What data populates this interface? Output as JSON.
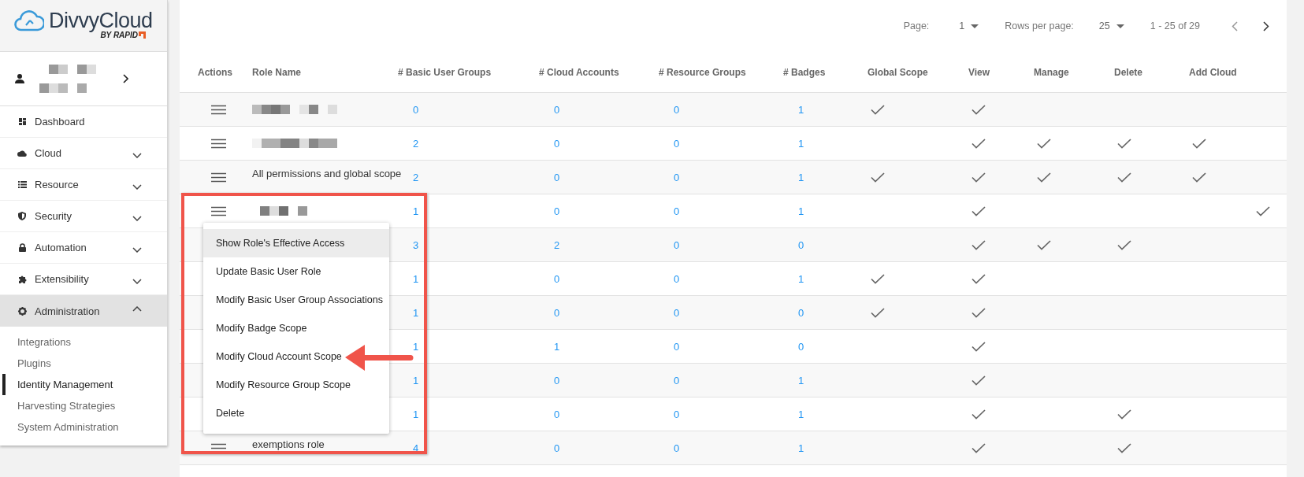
{
  "logo": {
    "name": "DivvyCloud",
    "byline": "BY RAPID"
  },
  "sidebar": {
    "items": [
      {
        "label": "Dashboard",
        "expandable": false,
        "expanded": false
      },
      {
        "label": "Cloud",
        "expandable": true,
        "expanded": false
      },
      {
        "label": "Resource",
        "expandable": true,
        "expanded": false
      },
      {
        "label": "Security",
        "expandable": true,
        "expanded": false
      },
      {
        "label": "Automation",
        "expandable": true,
        "expanded": false
      },
      {
        "label": "Extensibility",
        "expandable": true,
        "expanded": false
      },
      {
        "label": "Administration",
        "expandable": true,
        "expanded": true,
        "children": [
          {
            "label": "Integrations",
            "selected": false
          },
          {
            "label": "Plugins",
            "selected": false
          },
          {
            "label": "Identity Management",
            "selected": true
          },
          {
            "label": "Harvesting Strategies",
            "selected": false
          },
          {
            "label": "System Administration",
            "selected": false
          }
        ]
      }
    ]
  },
  "pagination": {
    "page_label": "Page:",
    "page": "1",
    "rows_label": "Rows per page:",
    "rows_per_page": "25",
    "range": "1 - 25 of 29"
  },
  "table": {
    "columns": [
      "Actions",
      "Role Name",
      "# Basic User Groups",
      "# Cloud Accounts",
      "# Resource Groups",
      "# Badges",
      "Global Scope",
      "View",
      "Manage",
      "Delete",
      "Add Cloud"
    ],
    "rows": [
      {
        "kind": "redacted",
        "basic_user_groups": "0",
        "cloud_accounts": "0",
        "resource_groups": "0",
        "badges": "1",
        "global_scope": true,
        "view": true,
        "manage": false,
        "delete": false,
        "add_cloud": false,
        "column_12": false
      },
      {
        "kind": "redacted",
        "basic_user_groups": "2",
        "cloud_accounts": "0",
        "resource_groups": "0",
        "badges": "1",
        "global_scope": false,
        "view": true,
        "manage": true,
        "delete": true,
        "add_cloud": true,
        "column_12": false
      },
      {
        "kind": "text",
        "name": "All permissions and global scope",
        "basic_user_groups": "2",
        "cloud_accounts": "0",
        "resource_groups": "0",
        "badges": "1",
        "global_scope": true,
        "view": true,
        "manage": true,
        "delete": true,
        "add_cloud": true,
        "column_12": false
      },
      {
        "kind": "redacted",
        "basic_user_groups": "1",
        "cloud_accounts": "0",
        "resource_groups": "0",
        "badges": "1",
        "global_scope": false,
        "view": true,
        "manage": false,
        "delete": false,
        "add_cloud": false,
        "column_12": true
      },
      {
        "kind": "covered",
        "basic_user_groups": "3",
        "cloud_accounts": "2",
        "resource_groups": "0",
        "badges": "0",
        "global_scope": false,
        "view": true,
        "manage": true,
        "delete": true,
        "add_cloud": false,
        "column_12": false
      },
      {
        "kind": "covered",
        "basic_user_groups": "1",
        "cloud_accounts": "0",
        "resource_groups": "0",
        "badges": "1",
        "global_scope": true,
        "view": true,
        "manage": false,
        "delete": false,
        "add_cloud": false,
        "column_12": false
      },
      {
        "kind": "covered",
        "basic_user_groups": "1",
        "cloud_accounts": "0",
        "resource_groups": "0",
        "badges": "0",
        "global_scope": true,
        "view": true,
        "manage": false,
        "delete": false,
        "add_cloud": false,
        "column_12": false
      },
      {
        "kind": "covered",
        "basic_user_groups": "1",
        "cloud_accounts": "1",
        "resource_groups": "0",
        "badges": "0",
        "global_scope": false,
        "view": true,
        "manage": false,
        "delete": false,
        "add_cloud": false,
        "column_12": false
      },
      {
        "kind": "covered",
        "basic_user_groups": "1",
        "cloud_accounts": "0",
        "resource_groups": "0",
        "badges": "1",
        "global_scope": false,
        "view": true,
        "manage": false,
        "delete": false,
        "add_cloud": false,
        "column_12": false
      },
      {
        "kind": "covered",
        "basic_user_groups": "1",
        "cloud_accounts": "0",
        "resource_groups": "0",
        "badges": "1",
        "global_scope": false,
        "view": true,
        "manage": false,
        "delete": true,
        "add_cloud": false,
        "column_12": false
      },
      {
        "kind": "text",
        "name": "exemptions role",
        "basic_user_groups": "4",
        "cloud_accounts": "0",
        "resource_groups": "0",
        "badges": "1",
        "global_scope": false,
        "view": true,
        "manage": false,
        "delete": true,
        "add_cloud": false,
        "column_12": false
      }
    ]
  },
  "action_menu": {
    "items": [
      {
        "label": "Show Role's Effective Access",
        "selected": true
      },
      {
        "label": "Update Basic User Role",
        "selected": false
      },
      {
        "label": "Modify Basic User Group Associations",
        "selected": false
      },
      {
        "label": "Modify Badge Scope",
        "selected": false
      },
      {
        "label": "Modify Cloud Account Scope",
        "selected": false
      },
      {
        "label": "Modify Resource Group Scope",
        "selected": false
      },
      {
        "label": "Delete",
        "selected": false
      }
    ]
  }
}
